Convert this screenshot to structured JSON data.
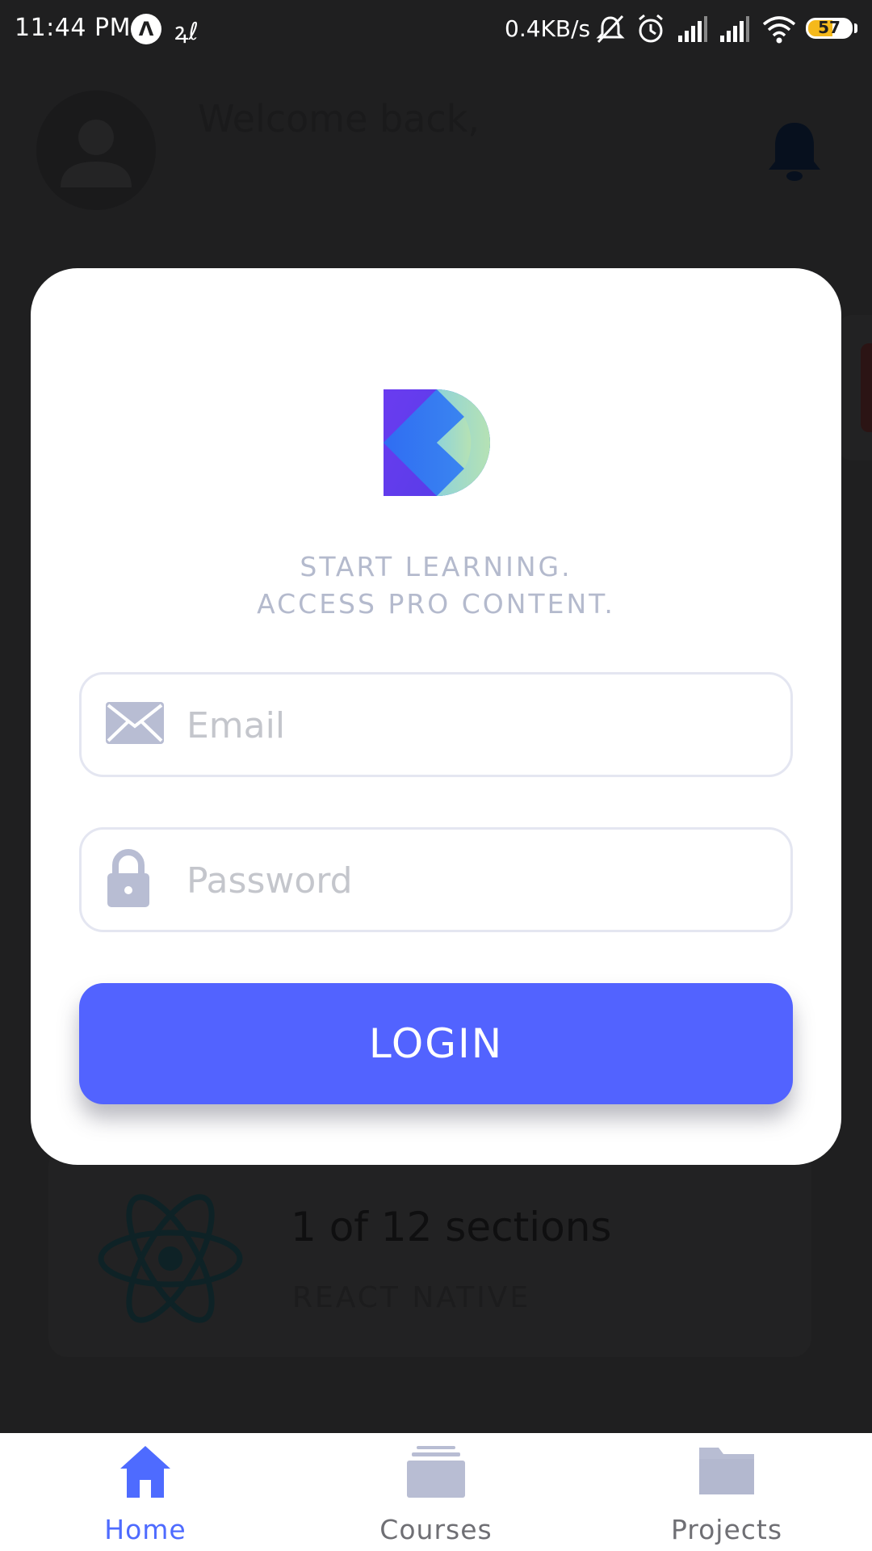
{
  "status_bar": {
    "time": "11:44 PM",
    "app_icon_1": "Λ",
    "app_icon_2": "ꝝℓ",
    "network_speed": "0.4KB/s",
    "battery_level": 57,
    "battery_text": "57",
    "icons": [
      "mute-icon",
      "alarm-icon",
      "signal-icon",
      "signal-icon",
      "wifi-icon",
      "battery-icon"
    ]
  },
  "background": {
    "welcome_text": "Welcome back,",
    "section_progress": "1 of 12 sections",
    "section_course": "REACT NATIVE"
  },
  "modal": {
    "tagline_line1": "START LEARNING.",
    "tagline_line2": "ACCESS PRO CONTENT.",
    "email": {
      "placeholder": "Email",
      "value": ""
    },
    "password": {
      "placeholder": "Password",
      "value": ""
    },
    "login_label": "LOGIN"
  },
  "tab_bar": {
    "items": [
      {
        "label": "Home",
        "icon": "home-icon",
        "active": true
      },
      {
        "label": "Courses",
        "icon": "courses-icon",
        "active": false
      },
      {
        "label": "Projects",
        "icon": "folder-icon",
        "active": false
      }
    ]
  },
  "colors": {
    "accent": "#5263ff",
    "active_tab": "#4e6bff",
    "inactive_tab": "#b8bdd3",
    "tagline": "#b4bacd",
    "backdrop": "#1f1f20"
  }
}
